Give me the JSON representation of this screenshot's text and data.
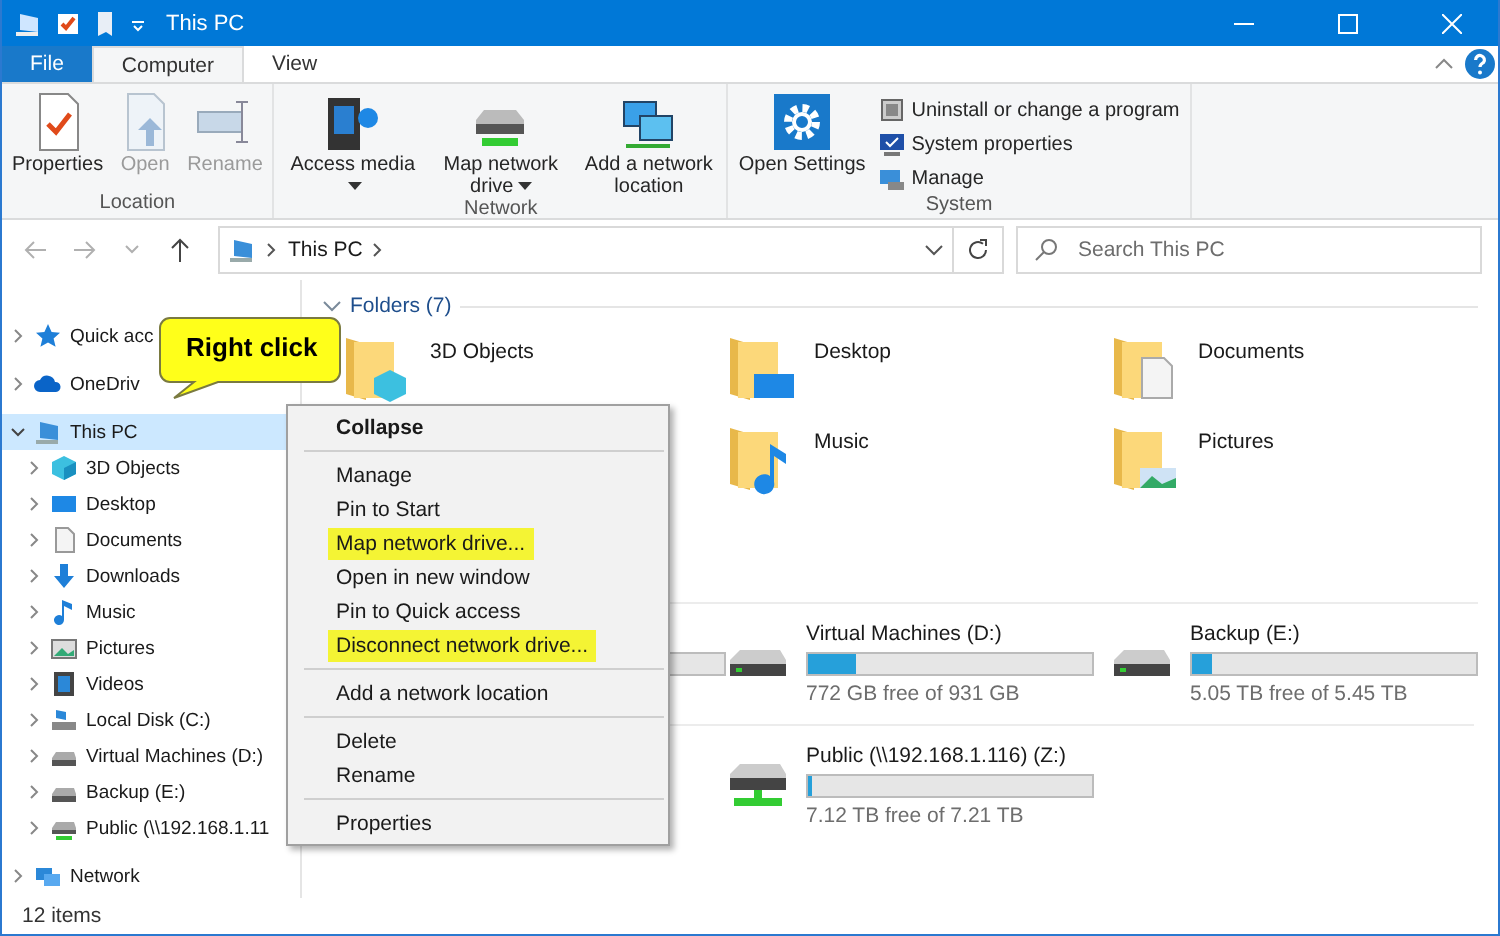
{
  "window": {
    "title": "This PC"
  },
  "ribbon_tabs": [
    {
      "label": "File",
      "kind": "file",
      "selected": false
    },
    {
      "label": "Computer",
      "kind": "tab",
      "selected": true
    },
    {
      "label": "View",
      "kind": "tab",
      "selected": false
    }
  ],
  "ribbon_groups": [
    {
      "label": "Location",
      "buttons": [
        {
          "label": "Properties",
          "kind": "properties",
          "disabled": false
        },
        {
          "label": "Open",
          "kind": "open",
          "disabled": true
        },
        {
          "label": "Rename",
          "kind": "rename",
          "disabled": true
        }
      ]
    },
    {
      "label": "Network",
      "buttons": [
        {
          "label": "Access media",
          "kind": "media",
          "disabled": false,
          "dropdown": true
        },
        {
          "label": "Map network drive",
          "kind": "mapdrive",
          "disabled": false,
          "dropdown": true
        },
        {
          "label": "Add a network location",
          "kind": "netloc",
          "disabled": false
        }
      ]
    },
    {
      "label": "System",
      "buttons": [
        {
          "label": "Open Settings",
          "kind": "settings",
          "disabled": false
        }
      ],
      "small_buttons": [
        {
          "label": "Uninstall or change a program",
          "kind": "uninstall"
        },
        {
          "label": "System properties",
          "kind": "sysprops"
        },
        {
          "label": "Manage",
          "kind": "manage"
        }
      ]
    }
  ],
  "address_bar": {
    "path": "This PC"
  },
  "search": {
    "placeholder": "Search This PC"
  },
  "navigation_pane": [
    {
      "label": "Quick acc",
      "kind": "star",
      "expanded": false
    },
    {
      "label": "OneDriv",
      "kind": "cloud",
      "expanded": false
    },
    {
      "label": "This PC",
      "kind": "pc",
      "expanded": true,
      "selected": true,
      "children": [
        {
          "label": "3D Objects",
          "kind": "objects",
          "expanded": false
        },
        {
          "label": "Desktop",
          "kind": "desktop",
          "expanded": false
        },
        {
          "label": "Documents",
          "kind": "documents",
          "expanded": false
        },
        {
          "label": "Downloads",
          "kind": "downloads",
          "expanded": false
        },
        {
          "label": "Music",
          "kind": "music",
          "expanded": false
        },
        {
          "label": "Pictures",
          "kind": "pictures",
          "expanded": false
        },
        {
          "label": "Videos",
          "kind": "videos",
          "expanded": false
        },
        {
          "label": "Local Disk (C:)",
          "kind": "sysdisk",
          "expanded": false
        },
        {
          "label": "Virtual Machines (D:)",
          "kind": "drive",
          "expanded": false
        },
        {
          "label": "Backup (E:)",
          "kind": "drive",
          "expanded": false
        },
        {
          "label": "Public (\\\\192.168.1.11",
          "kind": "netdrive",
          "expanded": false
        }
      ]
    },
    {
      "label": "Network",
      "kind": "network",
      "expanded": false
    }
  ],
  "folders": {
    "header": "Folders (7)",
    "items": [
      {
        "label": "3D Objects",
        "kind": "objects"
      },
      {
        "label": "Desktop",
        "kind": "desktop"
      },
      {
        "label": "Documents",
        "kind": "documents"
      },
      {
        "label": "Music",
        "kind": "music"
      },
      {
        "label": "Pictures",
        "kind": "pictures"
      }
    ]
  },
  "drives": [
    {
      "name": "Virtual Machines (D:)",
      "kind": "drive",
      "level": 0.17,
      "free": "772 GB free of 931 GB"
    },
    {
      "name": "Backup (E:)",
      "kind": "drive",
      "level": 0.07,
      "free": "5.05 TB free of 5.45 TB"
    },
    {
      "name": "Public (\\\\192.168.1.116) (Z:)",
      "kind": "netdrive",
      "level": 0.013,
      "free": "7.12 TB free of 7.21 TB"
    }
  ],
  "context_menu": [
    [
      {
        "label": "Collapse",
        "default": true,
        "highlighted": false
      }
    ],
    [
      {
        "label": "Manage",
        "highlighted": false
      },
      {
        "label": "Pin to Start",
        "highlighted": false
      },
      {
        "label": "Map network drive...",
        "highlighted": true
      },
      {
        "label": "Open in new window",
        "highlighted": false
      },
      {
        "label": "Pin to Quick access",
        "highlighted": false
      },
      {
        "label": "Disconnect network drive...",
        "highlighted": true
      }
    ],
    [
      {
        "label": "Add a network location",
        "highlighted": false
      }
    ],
    [
      {
        "label": "Delete",
        "highlighted": false
      },
      {
        "label": "Rename",
        "highlighted": false
      }
    ],
    [
      {
        "label": "Properties",
        "highlighted": false
      }
    ]
  ],
  "callout": {
    "text": "Right click"
  },
  "status_bar": {
    "items": "12 items"
  }
}
